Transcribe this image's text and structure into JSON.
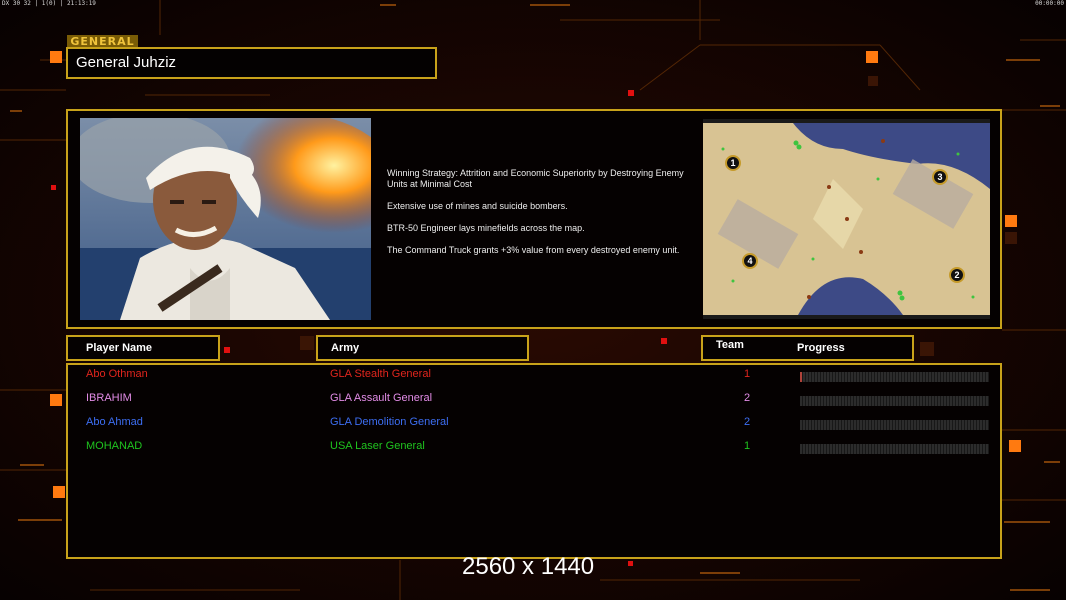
{
  "hud": {
    "left": "DX 30 32 | 1(0) | 21:13:19",
    "right": "00:00:00"
  },
  "general_tag": "GENERAL",
  "general_name": "General Juhziz",
  "strategy": [
    "Winning Strategy: Attrition and Economic Superiority by Destroying Enemy Units at Minimal Cost",
    "Extensive use of mines and suicide bombers.",
    "BTR-50 Engineer lays minefields across the map.",
    "The Command Truck grants +3% value from every destroyed enemy unit."
  ],
  "map": {
    "start_positions": [
      "1",
      "2",
      "3",
      "4"
    ]
  },
  "table": {
    "headers": {
      "player": "Player Name",
      "army": "Army",
      "team": "Team",
      "progress": "Progress"
    },
    "rows": [
      {
        "player": "Abo Othman",
        "army": "GLA Stealth General",
        "team": "1",
        "color": "#e0251d",
        "progress": 0.01
      },
      {
        "player": "IBRAHIM",
        "army": "GLA Assault General",
        "team": "2",
        "color": "#e28ce6",
        "progress": 0
      },
      {
        "player": "Abo Ahmad",
        "army": "GLA Demolition General",
        "team": "2",
        "color": "#3d6ef2",
        "progress": 0
      },
      {
        "player": "MOHANAD",
        "army": "USA Laser General",
        "team": "1",
        "color": "#1fc41f",
        "progress": 0
      }
    ]
  },
  "resolution_label": "2560 x 1440",
  "colors": {
    "frame": "#c8a21a",
    "accent_orange": "#ff7a10"
  }
}
